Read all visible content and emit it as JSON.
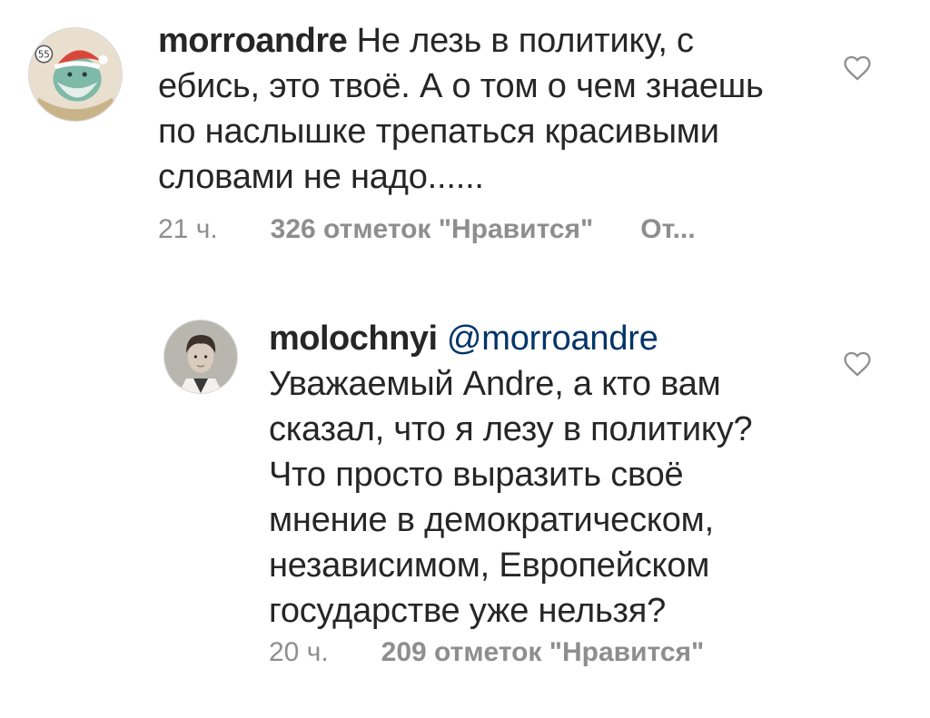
{
  "comments": [
    {
      "username": "morroandre",
      "mention": "",
      "lines": [
        "Не лезь в политику, с",
        "ебись, это твоё. А о том о чем знаешь",
        "по наслышке трепаться красивыми",
        "словами не надо......"
      ],
      "time": "21 ч.",
      "likes": "326 отметок \"Нравится\"",
      "reply": "От...",
      "avatar_icon": "santa-avatar",
      "avatar_badge": "55",
      "like_icon": "heart-outline-icon"
    },
    {
      "username": "molochnyi",
      "mention": "@morroandre",
      "lines": [
        "Уважаемый Andre, а кто вам",
        "сказал, что я лезу в политику?",
        "Что просто выразить своё",
        "мнение в демократическом,",
        "независимом, Европейском",
        "государстве уже нельзя?"
      ],
      "time": "20 ч.",
      "likes": "209 отметок \"Нравится\"",
      "reply": "",
      "avatar_icon": "boy-photo-avatar",
      "like_icon": "heart-outline-icon"
    }
  ],
  "colors": {
    "text": "#262626",
    "meta": "#8e8e8e",
    "mention": "#003569",
    "icon": "#8e8e8e"
  }
}
